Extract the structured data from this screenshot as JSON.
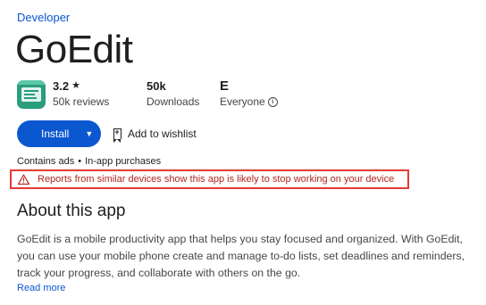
{
  "developer_link": "Developer",
  "app": {
    "name": "GoEdit",
    "icon": "goedit-app-icon",
    "brand_color": "#2a9d7b"
  },
  "stats": {
    "rating_value": "3.2",
    "rating_star": "★",
    "rating_label": "50k reviews",
    "downloads_value": "50k",
    "downloads_label": "Downloads",
    "content_rating_symbol": "E",
    "content_rating_label": "Everyone"
  },
  "actions": {
    "install_label": "Install",
    "install_caret": "▼",
    "wishlist_label": "Add to wishlist"
  },
  "ads_info": {
    "contains_ads": "Contains ads",
    "separator": "•",
    "in_app_purchases": "In-app purchases"
  },
  "warning": {
    "text": "Reports from similar devices show this app is likely to stop working on your device",
    "color": "#b3261e"
  },
  "about": {
    "title": "About this app",
    "description": "GoEdit is a mobile productivity app that helps you stay focused and organized. With GoEdit, you can use your mobile phone create and manage to-do lists, set deadlines and reminders, track your progress, and collaborate with others on the go.",
    "read_more": "Read more"
  },
  "colors": {
    "accent": "#0b57d0",
    "warning_border": "#e53935"
  }
}
